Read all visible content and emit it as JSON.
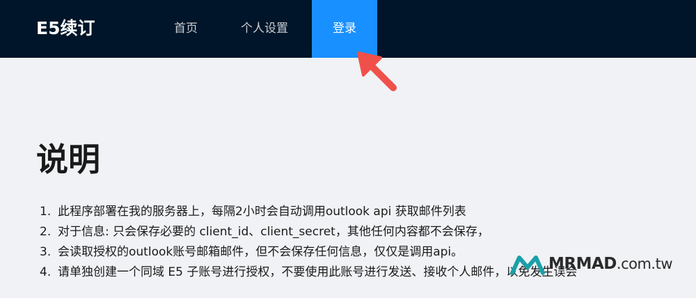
{
  "header": {
    "brand": "E5续订",
    "nav": {
      "home": "首页",
      "settings": "个人设置",
      "login": "登录"
    },
    "active_color": "#1890ff",
    "bg_color": "#001529"
  },
  "main": {
    "title": "说明",
    "items": [
      {
        "num": "1.",
        "text": "此程序部署在我的服务器上，每隔2小时会自动调用outlook api 获取邮件列表"
      },
      {
        "num": "2.",
        "text": "对于信息: 只会保存必要的 client_id、client_secret，其他任何内容都不会保存，"
      },
      {
        "num": "3.",
        "text": "会读取授权的outlook账号邮箱邮件，但不会保存任何信息，仅仅是调用api。"
      },
      {
        "num": "4.",
        "text": "请单独创建一个同域 E5 子账号进行授权，不要使用此账号进行发送、接收个人邮件，以免发生误会"
      }
    ]
  },
  "watermark": {
    "brand": "MRMAD",
    "tld": ".com.tw",
    "logo_icon": "mrmad-logo-icon"
  },
  "annotation": {
    "arrow_icon": "red-arrow-icon",
    "arrow_color": "#f0504a"
  }
}
